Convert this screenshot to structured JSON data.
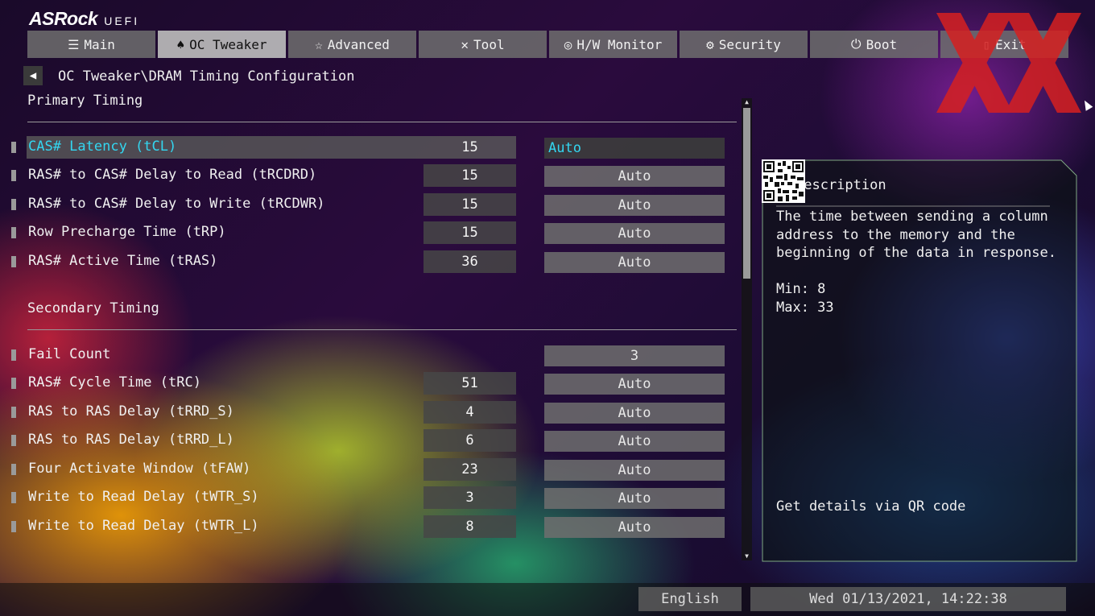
{
  "brand": {
    "name": "ASRock",
    "sub": "UEFI"
  },
  "tabs": [
    {
      "label": "Main",
      "icon": "list-icon"
    },
    {
      "label": "OC Tweaker",
      "icon": "rocket-icon",
      "active": true
    },
    {
      "label": "Advanced",
      "icon": "star-icon"
    },
    {
      "label": "Tool",
      "icon": "tools-icon"
    },
    {
      "label": "H/W Monitor",
      "icon": "monitor-icon"
    },
    {
      "label": "Security",
      "icon": "shield-icon"
    },
    {
      "label": "Boot",
      "icon": "power-icon"
    },
    {
      "label": "Exit",
      "icon": "exit-icon"
    }
  ],
  "breadcrumb": "OC Tweaker\\DRAM Timing Configuration",
  "sections": {
    "primary": "Primary Timing",
    "secondary": "Secondary Timing"
  },
  "primary_rows": [
    {
      "label": "CAS# Latency (tCL)",
      "value": "15",
      "setting": "Auto",
      "selected": true
    },
    {
      "label": "RAS# to CAS# Delay to Read  (tRCDRD)",
      "value": "15",
      "setting": "Auto"
    },
    {
      "label": "RAS# to CAS# Delay to Write (tRCDWR)",
      "value": "15",
      "setting": "Auto"
    },
    {
      "label": "Row Precharge Time (tRP)",
      "value": "15",
      "setting": "Auto"
    },
    {
      "label": "RAS# Active Time (tRAS)",
      "value": "36",
      "setting": "Auto"
    }
  ],
  "secondary_rows": [
    {
      "label": "Fail Count",
      "value": "",
      "setting": "3"
    },
    {
      "label": "RAS# Cycle Time (tRC)",
      "value": "51",
      "setting": "Auto"
    },
    {
      "label": "RAS to RAS Delay (tRRD_S)",
      "value": "4",
      "setting": "Auto"
    },
    {
      "label": "RAS to RAS Delay (tRRD_L)",
      "value": "6",
      "setting": "Auto"
    },
    {
      "label": "Four Activate Window (tFAW)",
      "value": "23",
      "setting": "Auto"
    },
    {
      "label": "Write to Read Delay (tWTR_S)",
      "value": "3",
      "setting": "Auto"
    },
    {
      "label": "Write to Read Delay (tWTR_L)",
      "value": "8",
      "setting": "Auto"
    }
  ],
  "description": {
    "title": "Description",
    "text": "The time between sending a column address to the memory and the beginning of the data in response.",
    "min": "Min: 8",
    "max": "Max: 33",
    "qr_text": "Get details via QR code"
  },
  "footer": {
    "language": "English",
    "datetime": "Wed 01/13/2021, 14:22:38"
  },
  "colors": {
    "highlight": "#33d6f0",
    "watermark": "#d62020"
  }
}
